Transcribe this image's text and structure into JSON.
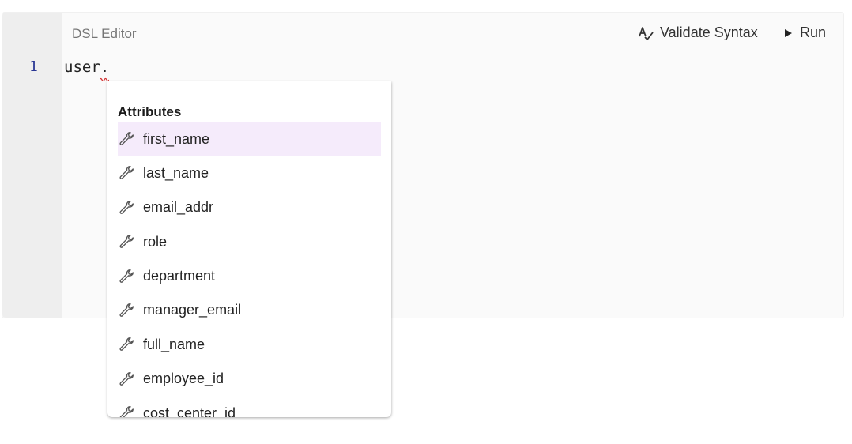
{
  "editor": {
    "title": "DSL Editor",
    "line_number": "1",
    "code": "user."
  },
  "toolbar": {
    "validate_label": "Validate Syntax",
    "run_label": "Run"
  },
  "suggest": {
    "header": "Attributes",
    "items": [
      {
        "label": "first_name",
        "icon": "wrench-icon",
        "selected": true
      },
      {
        "label": "last_name",
        "icon": "wrench-icon"
      },
      {
        "label": "email_addr",
        "icon": "wrench-icon"
      },
      {
        "label": "role",
        "icon": "wrench-icon"
      },
      {
        "label": "department",
        "icon": "wrench-icon"
      },
      {
        "label": "manager_email",
        "icon": "wrench-icon"
      },
      {
        "label": "full_name",
        "icon": "wrench-icon"
      },
      {
        "label": "employee_id",
        "icon": "wrench-icon"
      },
      {
        "label": "cost_center_id",
        "icon": "wrench-icon"
      }
    ]
  },
  "colors": {
    "selected_bg": "#f5ebfb",
    "error_squiggle": "#d32f2f",
    "line_number": "#283593"
  }
}
